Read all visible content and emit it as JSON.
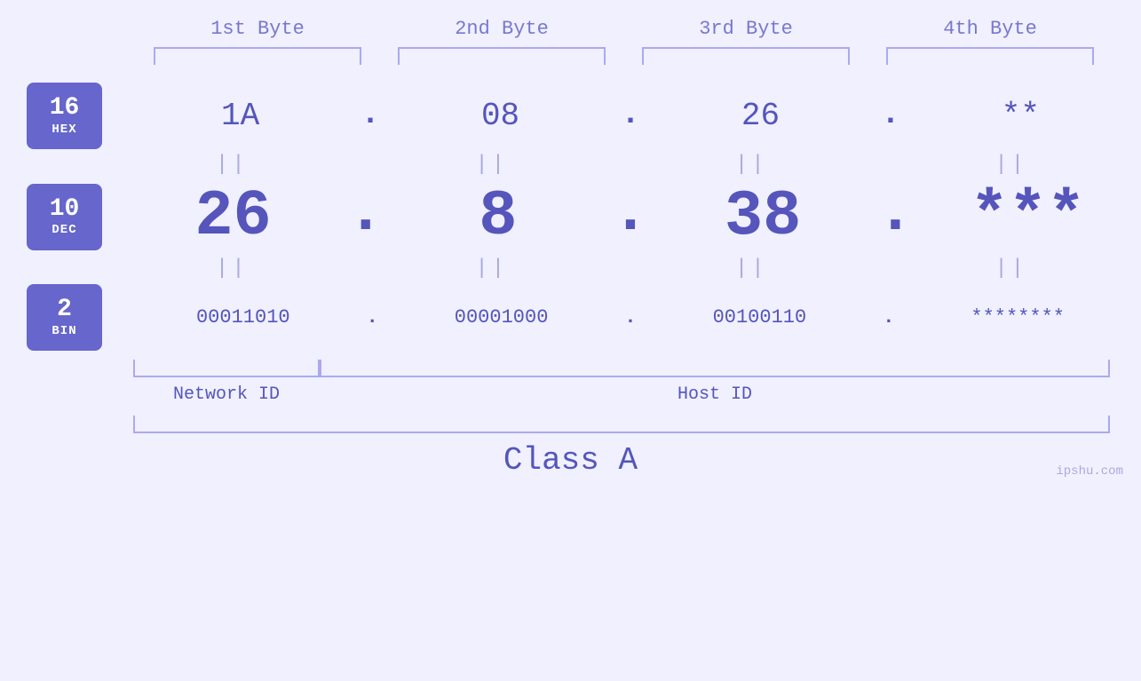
{
  "headers": {
    "byte1": "1st Byte",
    "byte2": "2nd Byte",
    "byte3": "3rd Byte",
    "byte4": "4th Byte"
  },
  "rows": {
    "hex": {
      "badge_number": "16",
      "badge_label": "HEX",
      "values": [
        "1A",
        "08",
        "26",
        "**"
      ],
      "dots": [
        ".",
        ".",
        ".",
        ""
      ]
    },
    "dec": {
      "badge_number": "10",
      "badge_label": "DEC",
      "values": [
        "26",
        "8",
        "38",
        "***"
      ],
      "dots": [
        ".",
        ".",
        ".",
        ""
      ]
    },
    "bin": {
      "badge_number": "2",
      "badge_label": "BIN",
      "values": [
        "00011010",
        "00001000",
        "00100110",
        "********"
      ],
      "dots": [
        ".",
        ".",
        ".",
        ""
      ]
    }
  },
  "labels": {
    "network_id": "Network ID",
    "host_id": "Host ID",
    "class": "Class A"
  },
  "watermark": "ipshu.com",
  "equals_symbol": "||"
}
